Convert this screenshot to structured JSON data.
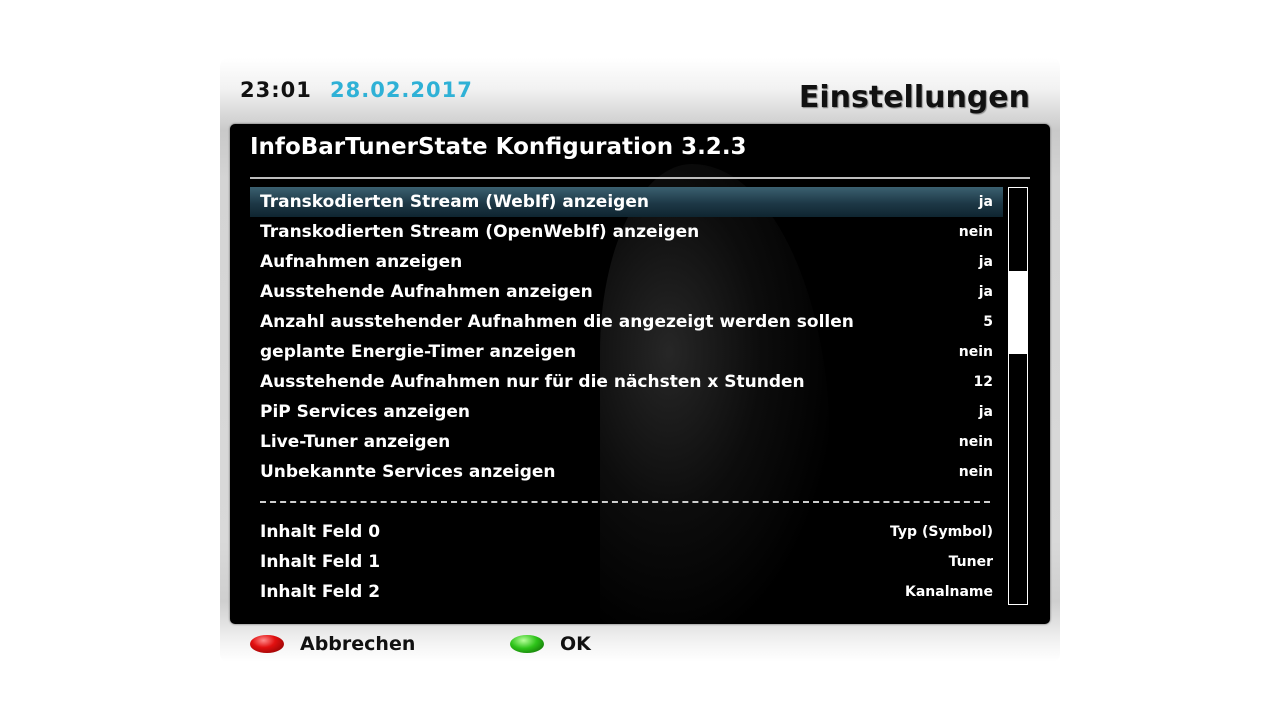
{
  "header": {
    "time": "23:01",
    "date": "28.02.2017",
    "screen_title": "Einstellungen"
  },
  "panel": {
    "title": "InfoBarTunerState Konfiguration 3.2.3"
  },
  "settings": [
    {
      "label": "Transkodierten Stream (WebIf) anzeigen",
      "value": "ja",
      "selected": true
    },
    {
      "label": "Transkodierten Stream (OpenWebIf) anzeigen",
      "value": "nein"
    },
    {
      "label": "Aufnahmen anzeigen",
      "value": "ja"
    },
    {
      "label": "Ausstehende Aufnahmen anzeigen",
      "value": "ja"
    },
    {
      "label": "Anzahl ausstehender Aufnahmen die angezeigt werden sollen",
      "value": "5"
    },
    {
      "label": "geplante Energie-Timer anzeigen",
      "value": "nein"
    },
    {
      "label": "Ausstehende Aufnahmen nur für die nächsten x Stunden",
      "value": "12"
    },
    {
      "label": "PiP Services anzeigen",
      "value": "ja"
    },
    {
      "label": "Live-Tuner anzeigen",
      "value": "nein"
    },
    {
      "label": "Unbekannte Services anzeigen",
      "value": "nein"
    },
    {
      "label": "Inhalt Feld 0",
      "value": "Typ (Symbol)"
    },
    {
      "label": "Inhalt Feld 1",
      "value": "Tuner"
    },
    {
      "label": "Inhalt Feld 2",
      "value": "Kanalname"
    }
  ],
  "scrollbar": {
    "thumb_start_fraction": 0.2,
    "thumb_size_fraction": 0.2
  },
  "footer": {
    "red_label": "Abbrechen",
    "green_label": "OK"
  },
  "colors": {
    "date": "#2fb1d6",
    "red_button": "#e21010",
    "green_button": "#2ec41a",
    "selection": "#1d3846"
  }
}
